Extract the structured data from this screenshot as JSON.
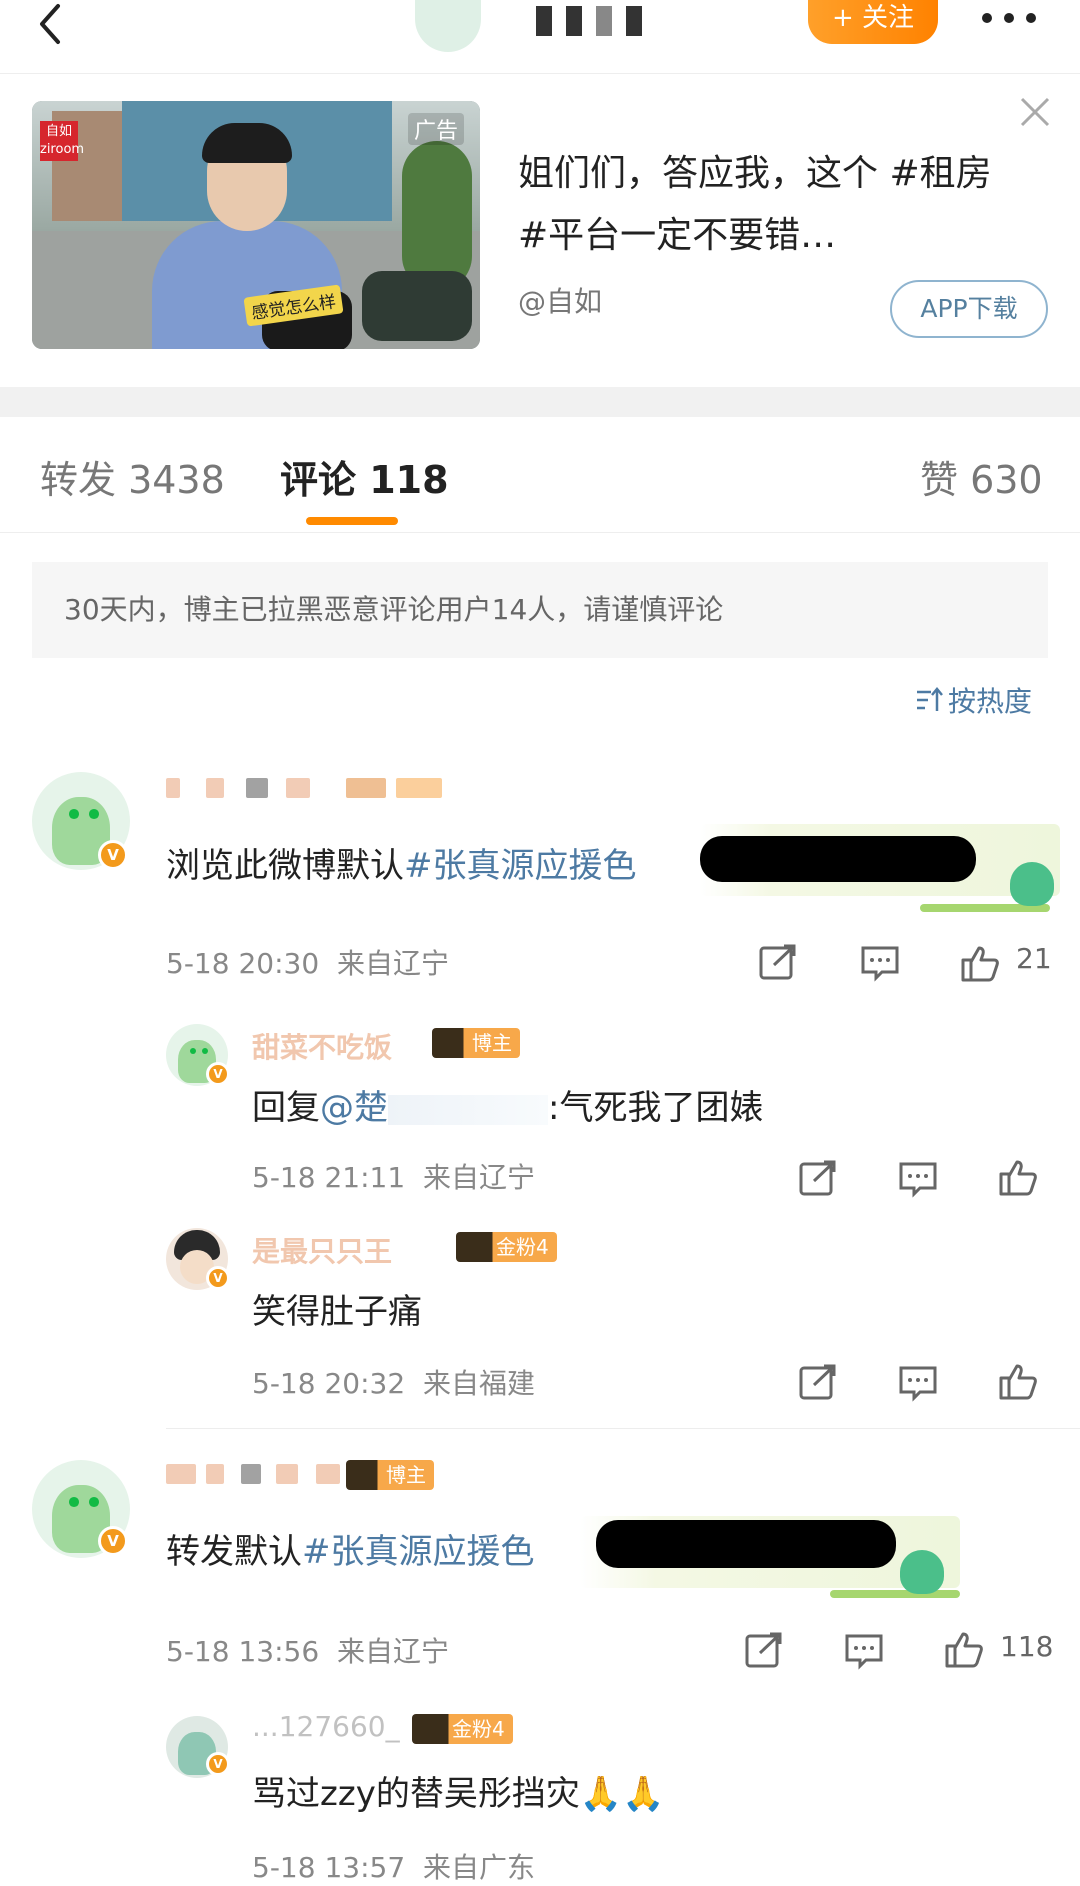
{
  "topbar": {
    "follow_label": "+ 关注"
  },
  "ad": {
    "tag": "广告",
    "image_caption": "感觉怎么样",
    "logo": "自如 ziroom",
    "title": "姐们们，答应我，这个 #租房#平台一定不要错…",
    "source": "@自如",
    "download_label": "APP下载"
  },
  "tabs": [
    {
      "label": "转发 3438"
    },
    {
      "label": "评论 118"
    },
    {
      "label": "赞 630"
    }
  ],
  "notice": "30天内，博主已拉黑恶意评论用户14人，请谨慎评论",
  "sort_label": "按热度",
  "comments": [
    {
      "text_plain": "浏览此微博默认",
      "text_tag": "#张真源应援色",
      "time": "5-18 20:30",
      "location": "来自辽宁",
      "likes": "21"
    },
    {
      "role": "博主",
      "name": "甜菜不吃饭",
      "text_prefix": "回复",
      "text_at": "@楚",
      "text_rest": ":气死我了团婊",
      "time": "5-18 21:11",
      "location": "来自辽宁"
    },
    {
      "role": "金粉4",
      "name": "是最只只王",
      "text": "笑得肚子痛",
      "time": "5-18 20:32",
      "location": "来自福建"
    },
    {
      "role": "博主",
      "text_plain": "转发默认",
      "text_tag": "#张真源应援色",
      "time": "5-18 13:56",
      "location": "来自辽宁",
      "likes": "118"
    },
    {
      "role": "金粉4",
      "name": "...127660_",
      "text": "骂过zzy的替吴彤挡灾🙏🙏",
      "time": "5-18 13:57",
      "location": "来自广东"
    }
  ],
  "icons": {
    "back": "chevron-left-icon",
    "more": "more-dots-icon",
    "close": "close-icon",
    "share": "share-icon",
    "comment": "comment-icon",
    "like": "thumbs-up-icon",
    "sort": "sort-icon"
  },
  "colors": {
    "accent": "#ff8200",
    "link": "#4d7aa3",
    "vip": "#f39a1c"
  }
}
